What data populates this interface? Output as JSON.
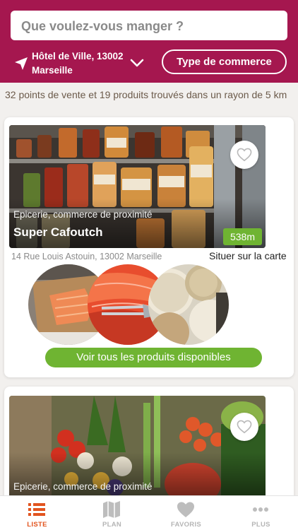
{
  "header": {
    "search_placeholder": "Que voulez-vous manger ?",
    "location_line1": "Hôtel de Ville, 13002",
    "location_line2": "Marseille",
    "type_button": "Type de commerce",
    "color": "#a5174f"
  },
  "results_text": "32 points de vente et 19 produits trouvés dans un rayon de 5 km",
  "cards": [
    {
      "category": "Epicerie, commerce de proximité",
      "name": "Super Cafoutch",
      "distance": "538m",
      "address": "14 Rue Louis Astouin, 13002 Marseille",
      "map_link": "Situer sur la carte",
      "products_button": "Voir tous les produits disponibles",
      "products": [
        "saumon",
        "saumon fumé",
        "fromages"
      ]
    },
    {
      "category": "Epicerie, commerce de proximité"
    }
  ],
  "tabs": [
    {
      "label": "LISTE",
      "icon": "list-icon",
      "active": true
    },
    {
      "label": "PLAN",
      "icon": "map-icon",
      "active": false
    },
    {
      "label": "FAVORIS",
      "icon": "heart-icon",
      "active": false
    },
    {
      "label": "PLUS",
      "icon": "more-icon",
      "active": false
    }
  ],
  "colors": {
    "accent": "#a5174f",
    "green": "#6fb432",
    "active_tab": "#e2541f"
  }
}
